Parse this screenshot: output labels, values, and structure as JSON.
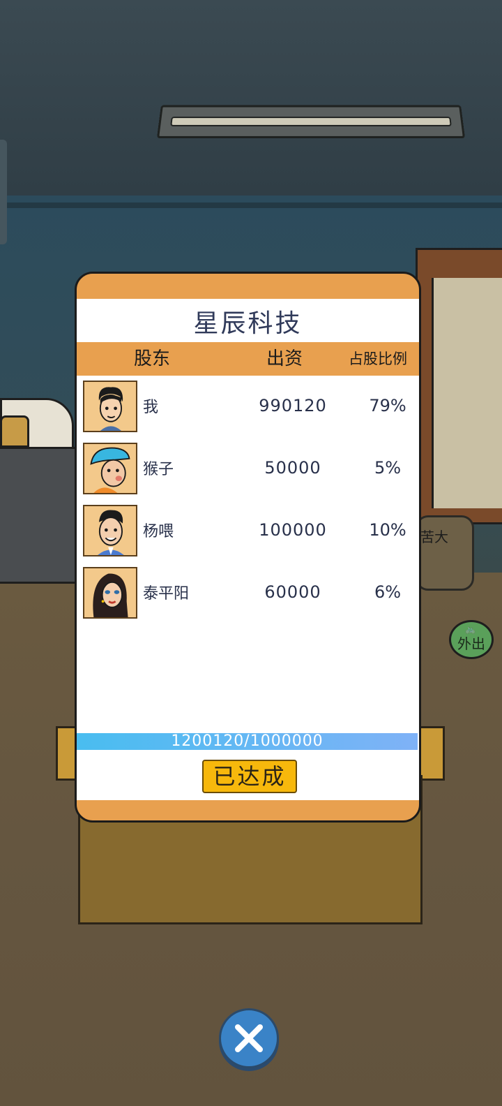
{
  "background": {
    "sign_text": "苦大",
    "go_out_label": "外出"
  },
  "dialog": {
    "company_name": "星辰科技",
    "headers": {
      "shareholder": "股东",
      "capital": "出资",
      "ratio": "占股比例"
    },
    "shareholders": [
      {
        "name": "我",
        "capital": "990120",
        "ratio": "79%",
        "avatar_icon": "player-avatar-icon"
      },
      {
        "name": "猴子",
        "capital": "50000",
        "ratio": "5%",
        "avatar_icon": "monkey-avatar-icon"
      },
      {
        "name": "杨喂",
        "capital": "100000",
        "ratio": "10%",
        "avatar_icon": "yang-avatar-icon"
      },
      {
        "name": "泰平阳",
        "capital": "60000",
        "ratio": "6%",
        "avatar_icon": "taipingyang-avatar-icon"
      }
    ],
    "progress": {
      "text": "1200120/1000000",
      "fraction": 1.0
    },
    "achieved_label": "已达成"
  },
  "colors": {
    "dialog_frame": "#e8a04f",
    "button": "#f7b80c",
    "close": "#3a83c7"
  }
}
